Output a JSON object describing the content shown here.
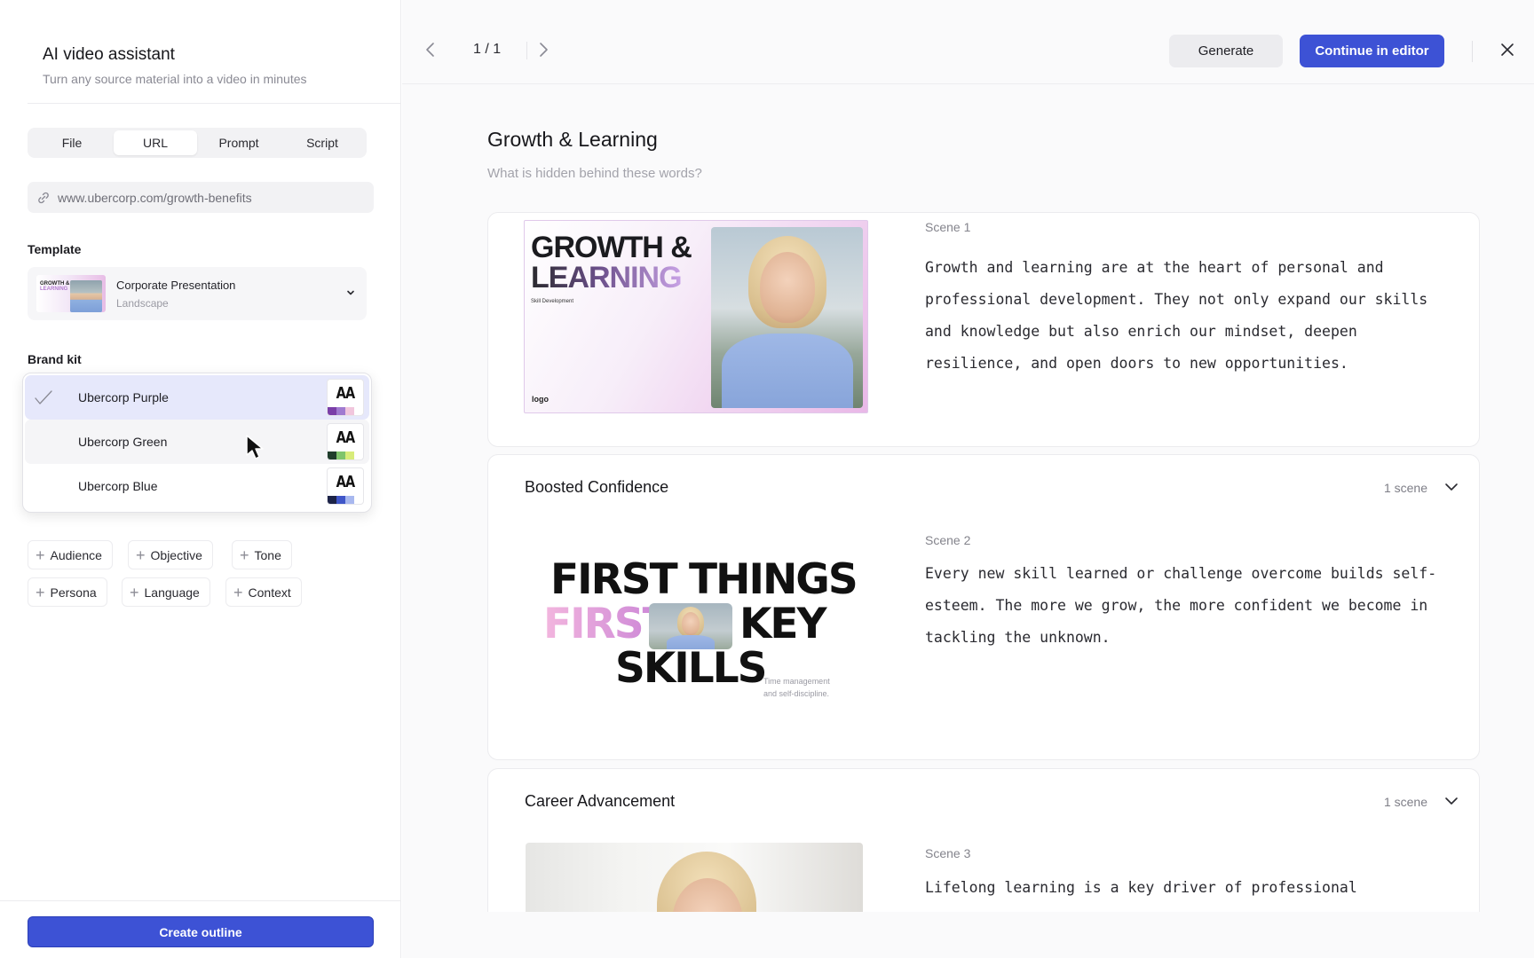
{
  "left_panel": {
    "title": "AI video assistant",
    "subtitle": "Turn any source material into a video in minutes",
    "source_tabs": [
      {
        "label": "File",
        "active": false
      },
      {
        "label": "URL",
        "active": true
      },
      {
        "label": "Prompt",
        "active": false
      },
      {
        "label": "Script",
        "active": false
      }
    ],
    "url_input": {
      "value": "www.ubercorp.com/growth-benefits",
      "icon": "link-icon"
    },
    "template_label": "Template",
    "template": {
      "name": "Corporate Presentation",
      "orientation": "Landscape",
      "thumb_line1": "GROWTH &",
      "thumb_line2": "LEARNING"
    },
    "brand_kit_label": "Brand kit",
    "brand_kits": [
      {
        "name": "Ubercorp Purple",
        "selected": true,
        "swatch_text": "AA",
        "colors": [
          "#7a3ea8",
          "#a07ad0",
          "#f1c6dd"
        ]
      },
      {
        "name": "Ubercorp Green",
        "selected": false,
        "swatch_text": "AA",
        "colors": [
          "#1f3d2b",
          "#7fc46c",
          "#d8ec7a"
        ]
      },
      {
        "name": "Ubercorp Blue",
        "selected": false,
        "swatch_text": "AA",
        "colors": [
          "#1c2347",
          "#3f56c8",
          "#a8b8ef"
        ]
      }
    ],
    "chips": [
      "Audience",
      "Objective",
      "Tone",
      "Persona",
      "Language",
      "Context"
    ],
    "create_button": "Create outline"
  },
  "toolbar": {
    "page_indicator": "1 / 1",
    "generate_label": "Generate",
    "continue_label": "Continue in editor"
  },
  "document": {
    "title": "Growth & Learning",
    "subtitle": "What is hidden behind these words?",
    "sections": [
      {
        "title": "",
        "scene_label": "Scene 1",
        "script": "Growth and learning are at the heart of personal and professional development. They not only expand our skills and knowledge but also enrich our mindset, deepen resilience, and open doors to new opportunities.",
        "slide": {
          "line1": "GROWTH &",
          "line2": "LEARNING",
          "kicker": "Skill Development",
          "logo": "logo"
        }
      },
      {
        "title": "Boosted Confidence",
        "count": "1 scene",
        "scene_label": "Scene 2",
        "script": "Every new skill learned or challenge overcome builds self-esteem. The more we grow, the more confident we become in tackling the unknown.",
        "slide": {
          "line1": "FIRST THINGS",
          "line2a": "FIRST",
          "line2b": "KEY",
          "line3": "SKILLS",
          "caption": "Time management and self-discipline."
        }
      },
      {
        "title": "Career Advancement",
        "count": "1 scene",
        "scene_label": "Scene 3",
        "script": "Lifelong learning is a key driver of professional"
      }
    ]
  },
  "colors": {
    "accent": "#3d52d5",
    "selected_row": "#e6e8fb"
  }
}
